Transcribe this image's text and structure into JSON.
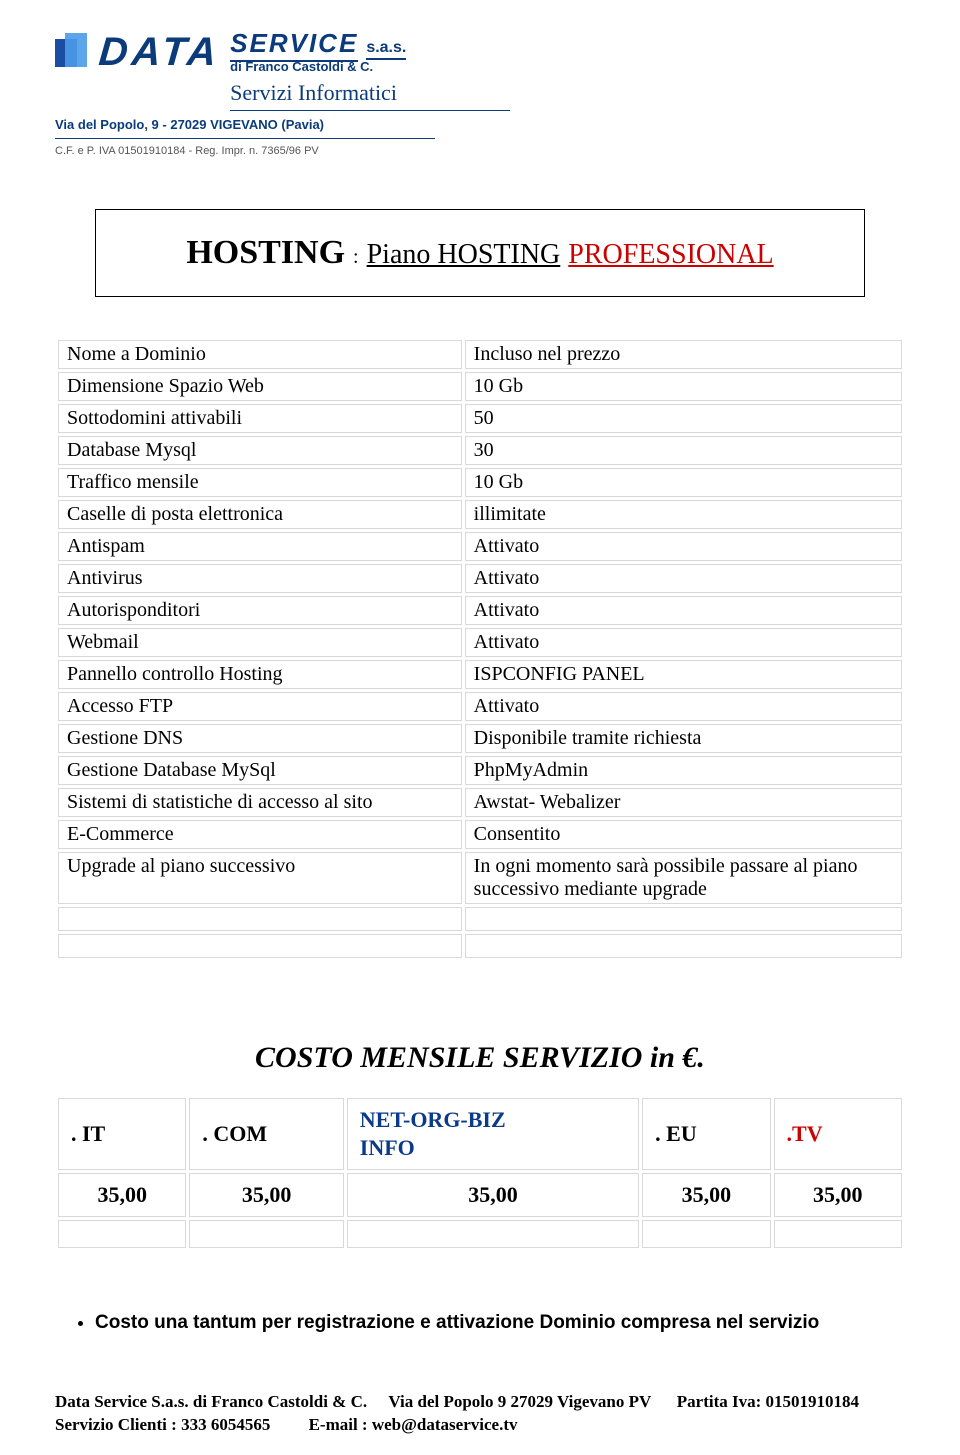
{
  "letterhead": {
    "brand_word1": "DATA",
    "brand_word2": "SERVICE",
    "brand_suffix": "s.a.s.",
    "subline": "di Franco Castoldi & C.",
    "script": "Servizi   Informatici",
    "address": "Via del Popolo, 9 - 27029 VIGEVANO (Pavia)",
    "cf": "C.F. e P. IVA 01501910184 - Reg. Impr. n. 7365/96 PV"
  },
  "title": {
    "hosting": "HOSTING",
    "colon": ":",
    "piano": "Piano   HOSTING",
    "plan_name": "PROFESSIONAL"
  },
  "spec_rows": [
    {
      "label": "Nome  a Dominio",
      "value": "Incluso nel prezzo"
    },
    {
      "label": "Dimensione Spazio Web",
      "value": " 10  Gb"
    },
    {
      "label": "Sottodomini attivabili",
      "value": " 50"
    },
    {
      "label": "Database Mysql",
      "value": "30"
    },
    {
      "label": "Traffico mensile",
      "value": " 10  Gb"
    },
    {
      "label": "Caselle di posta  elettronica",
      "value": " illimitate"
    },
    {
      "label": "Antispam",
      "value": "Attivato"
    },
    {
      "label": "Antivirus",
      "value": "Attivato"
    },
    {
      "label": "Autorisponditori",
      "value": " Attivato"
    },
    {
      "label": "Webmail",
      "value": "Attivato"
    },
    {
      "label": "Pannello controllo Hosting",
      "value": "ISPCONFIG  PANEL"
    },
    {
      "label": "Accesso  FTP",
      "value": "Attivato"
    },
    {
      "label": "Gestione  DNS",
      "value": "Disponibile tramite richiesta"
    },
    {
      "label": "Gestione Database MySql",
      "value": "PhpMyAdmin"
    },
    {
      "label": "Sistemi di statistiche di accesso al sito",
      "value": "Awstat- Webalizer"
    },
    {
      "label": " E-Commerce",
      "value": " Consentito"
    },
    {
      "label": "Upgrade al piano successivo",
      "value": "In ogni momento sarà possibile passare al piano successivo mediante upgrade"
    }
  ],
  "cost": {
    "heading": "COSTO   MENSILE  SERVIZIO  in  €.",
    "headers": {
      "it": ". IT",
      "com": ". COM",
      "net_line1": "NET-ORG-BIZ",
      "net_line2": "INFO",
      "eu": ". EU",
      "tv": ".TV"
    },
    "prices": [
      "35,00",
      "35,00",
      "35,00",
      "35,00",
      "35,00"
    ]
  },
  "note": {
    "bullet": "Costo una tantum per registrazione e attivazione Dominio compresa nel servizio"
  },
  "footer": {
    "company": "Data Service S.a.s. di Franco Castoldi & C.",
    "addr": "Via del Popolo 9  27029 Vigevano  PV",
    "piva_label": "Partita Iva:  ",
    "piva": "01501910184",
    "service_label": "Servizio Clienti :  ",
    "service_phone": "333 6054565",
    "email_label": "E-mail  :  ",
    "email": "web@dataservice.tv"
  },
  "chart_data": {
    "type": "table",
    "title": "COSTO MENSILE SERVIZIO in €.",
    "categories": [
      ".IT",
      ".COM",
      "NET-ORG-BIZ INFO",
      ".EU",
      ".TV"
    ],
    "values": [
      35.0,
      35.0,
      35.0,
      35.0,
      35.0
    ],
    "currency": "EUR"
  }
}
